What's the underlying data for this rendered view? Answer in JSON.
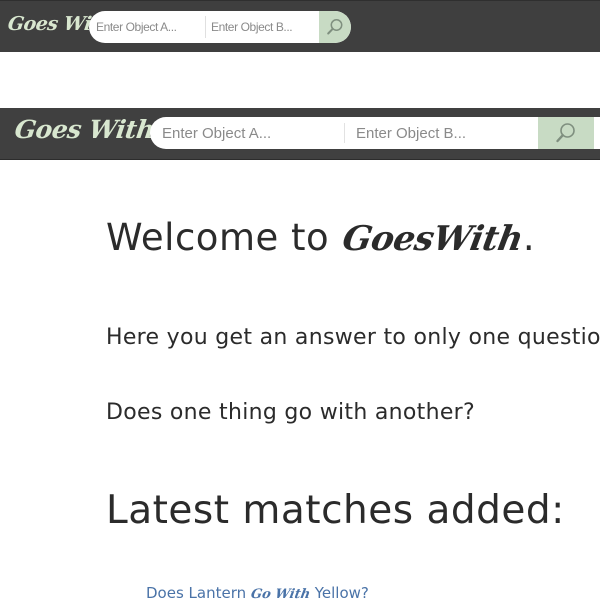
{
  "small_header": {
    "logo": "Goes With",
    "object_a_placeholder": "Enter Object A...",
    "object_b_placeholder": "Enter Object B...",
    "search_icon": "search-icon"
  },
  "main_header": {
    "logo": "Goes With",
    "object_a_placeholder": "Enter Object A...",
    "object_b_placeholder": "Enter Object B...",
    "search_icon": "search-icon"
  },
  "content": {
    "welcome_prefix": "Welcome to ",
    "welcome_brand": "GoesWith",
    "welcome_suffix": ".",
    "intro": "Here you get an answer to only one question.",
    "question": "Does one thing go with another?",
    "latest_heading": "Latest matches added:",
    "latest_matches": [
      {
        "prefix": "Does Lantern ",
        "middle": "Go With",
        "suffix": " Yellow?"
      }
    ]
  },
  "colors": {
    "header_bg": "#404040",
    "logo": "#d8e7cf",
    "search_button": "#c8dbc4",
    "link": "#4a73a8",
    "text": "#2b2b2b"
  }
}
